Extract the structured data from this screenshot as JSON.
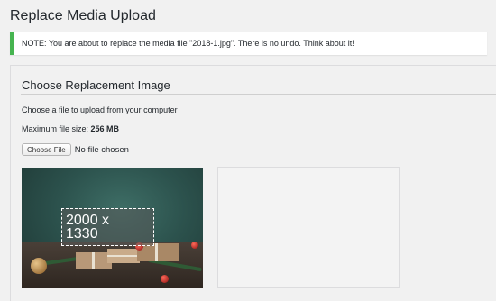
{
  "page": {
    "title": "Replace Media Upload"
  },
  "notice": {
    "text": "NOTE: You are about to replace the media file \"2018-1.jpg\". There is no undo. Think about it!",
    "accent_color": "#46b450"
  },
  "section": {
    "title": "Choose Replacement Image",
    "help_text": "Choose a file to upload from your computer",
    "max_size_label": "Maximum file size: ",
    "max_size_value": "256 MB"
  },
  "file_input": {
    "button_label": "Choose File",
    "status": "No file chosen"
  },
  "preview": {
    "dimensions_line1": "2000 x",
    "dimensions_line2": "1330"
  }
}
